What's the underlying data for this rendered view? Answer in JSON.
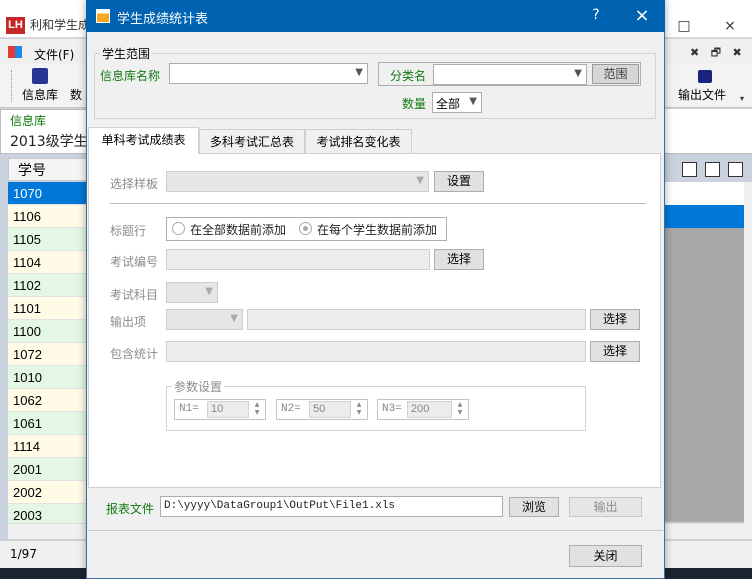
{
  "background_app": {
    "title": "利和学生成",
    "logo_text": "LH",
    "window_controls": [
      "□",
      "×"
    ],
    "menu": {
      "file": "文件(F)",
      "right_controls": "✖ 🗗 ✖"
    },
    "toolbar": {
      "database": "信息库",
      "stats": "数",
      "export": "输出文件",
      "more": "▾"
    },
    "db_panel": {
      "label": "信息库",
      "value": "2013级学生"
    },
    "grid": {
      "column_header": "学号",
      "rows": [
        "1070",
        "1106",
        "1105",
        "1104",
        "1102",
        "1101",
        "1100",
        "1072",
        "1010",
        "1062",
        "1061",
        "1114",
        "2001",
        "2002",
        "2003"
      ],
      "row_colors": [
        "#e4f7e4",
        "#fffbe6"
      ],
      "selected_color": "#0078d7"
    },
    "status": "1/97"
  },
  "dialog": {
    "title": "学生成绩统计表",
    "help_label": "?",
    "close_label": "×",
    "scope": {
      "group_title": "学生范围",
      "db_name_label": "信息库名称",
      "db_name_value": "",
      "category_label": "分类名",
      "category_value": "",
      "range_button": "范围",
      "count_label": "数量",
      "count_value": "全部"
    },
    "tabs": [
      {
        "label": "单科考试成绩表",
        "active": true
      },
      {
        "label": "多科考试汇总表",
        "active": false
      },
      {
        "label": "考试排名变化表",
        "active": false
      }
    ],
    "single_exam": {
      "template_label": "选择样板",
      "template_button": "设置",
      "header_row_label": "标题行",
      "header_option_1": "在全部数据前添加",
      "header_option_2": "在每个学生数据前添加",
      "exam_no_label": "考试编号",
      "exam_no_button": "选择",
      "subject_label": "考试科目",
      "output_label": "输出项",
      "output_button": "选择",
      "stats_label": "包含统计",
      "stats_button": "选择",
      "params": {
        "group_title": "参数设置",
        "n1_label": "N1=",
        "n1_value": "10",
        "n2_label": "N2=",
        "n2_value": "50",
        "n3_label": "N3=",
        "n3_value": "200"
      }
    },
    "report": {
      "label": "报表文件",
      "path": "D:\\yyyy\\DataGroup1\\OutPut\\File1.xls",
      "browse_button": "浏览",
      "output_button": "输出"
    },
    "close_button": "关闭"
  }
}
